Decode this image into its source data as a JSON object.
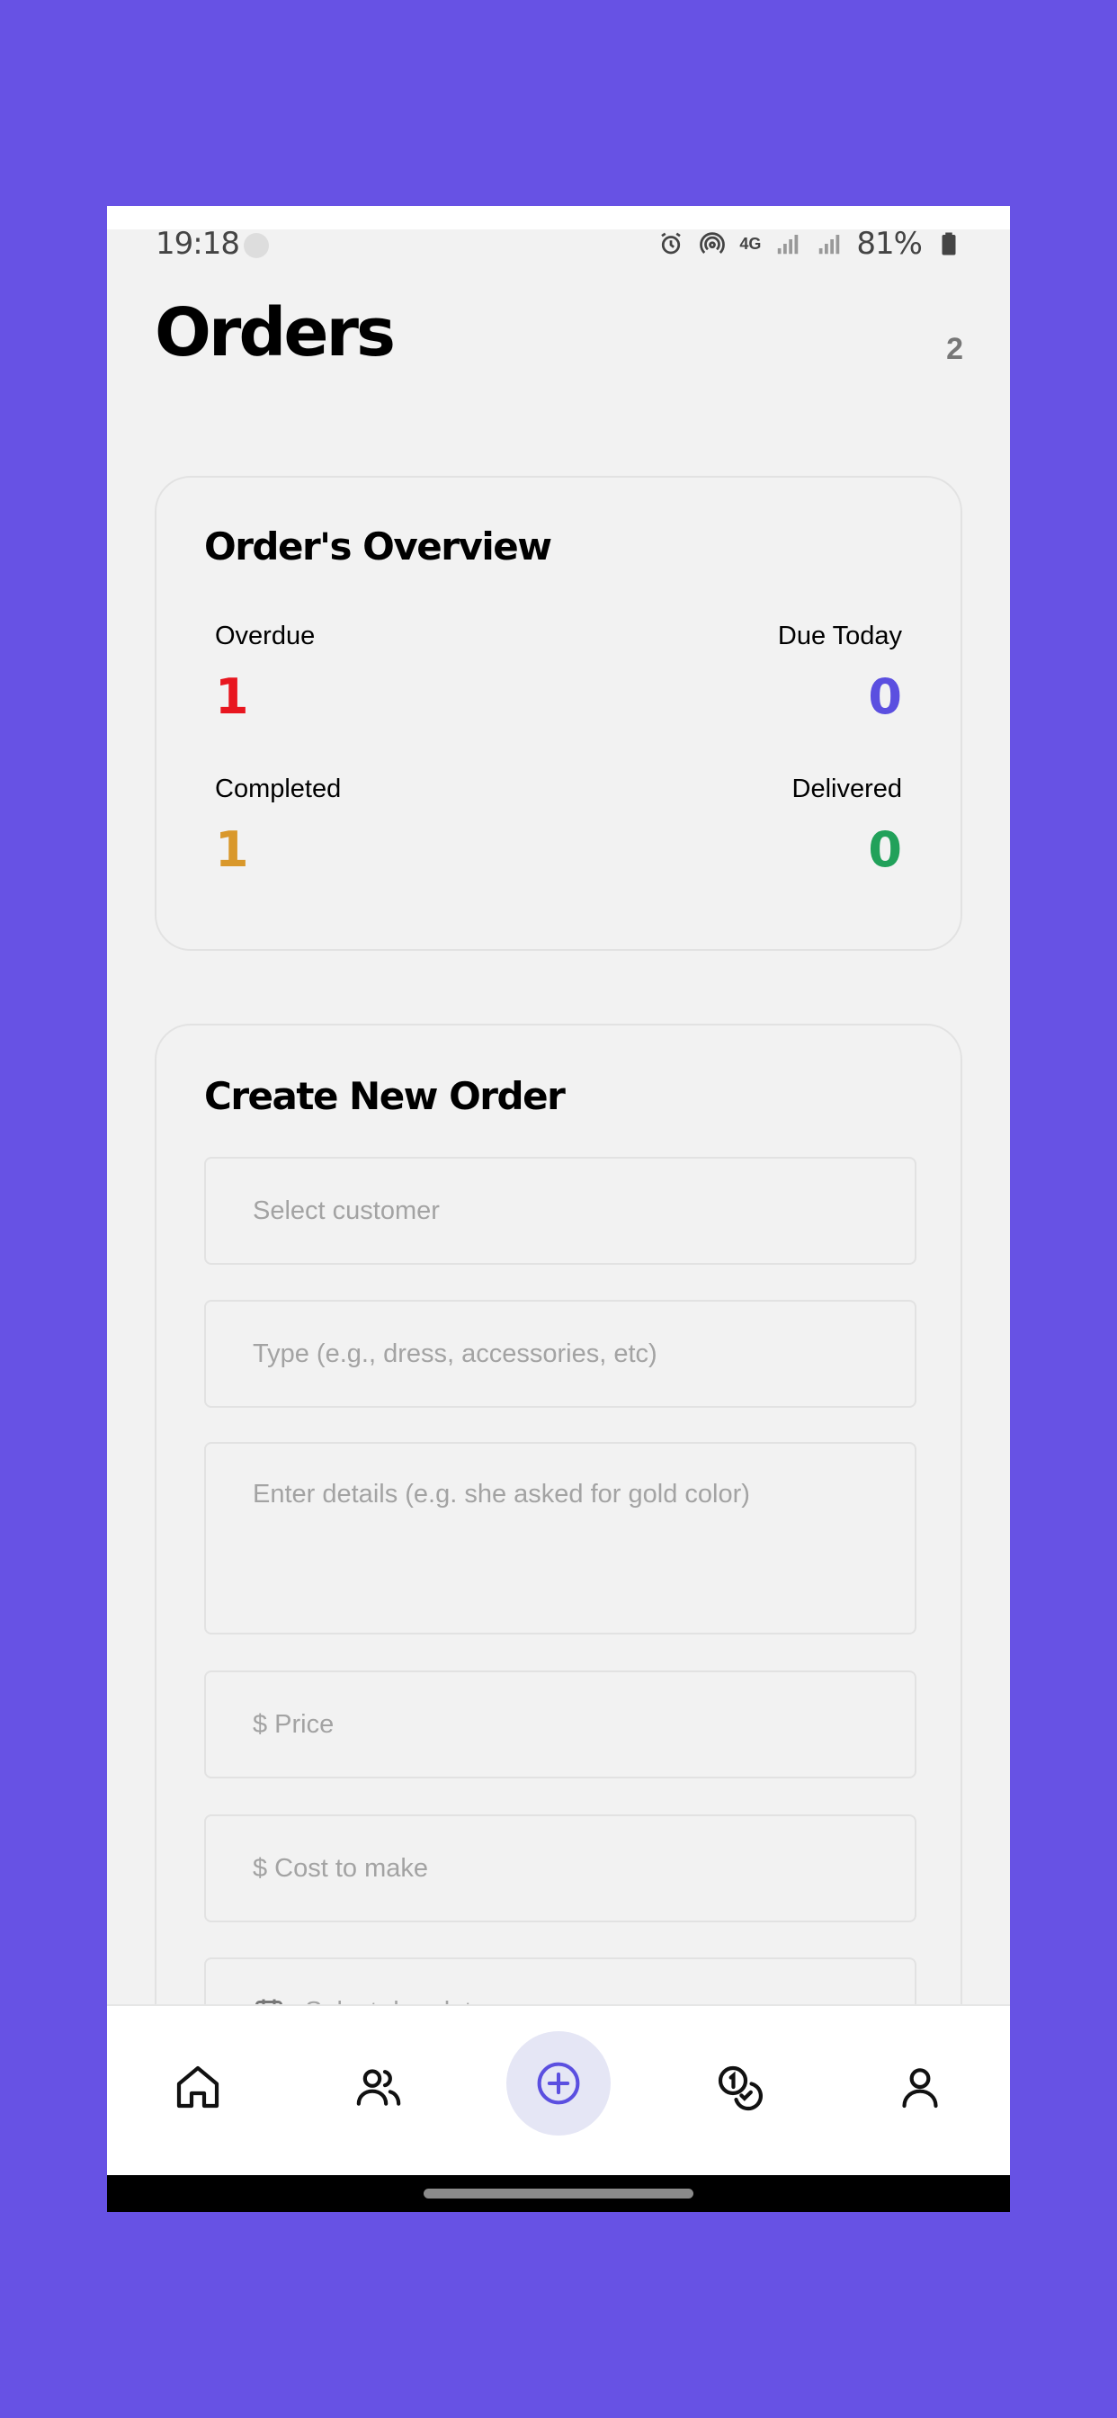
{
  "status_bar": {
    "time": "19:18",
    "network": "4G",
    "battery": "81%"
  },
  "header": {
    "title": "Orders",
    "badge": "2"
  },
  "overview": {
    "title": "Order's Overview",
    "stats": [
      {
        "label": "Overdue",
        "value": "1",
        "color": "#E8161F"
      },
      {
        "label": "Due Today",
        "value": "0",
        "color": "#5B4FE0"
      },
      {
        "label": "Completed",
        "value": "1",
        "color": "#D9982B"
      },
      {
        "label": "Delivered",
        "value": "0",
        "color": "#21A15A"
      }
    ]
  },
  "create_order": {
    "title": "Create New Order",
    "customer_placeholder": "Select customer",
    "type_placeholder": "Type (e.g., dress, accessories, etc)",
    "details_placeholder": "Enter details (e.g. she asked for gold color)",
    "price_placeholder": "$ Price",
    "cost_placeholder": "$ Cost to make",
    "due_date_placeholder": "Select due date"
  },
  "bottom_nav": {
    "items": [
      "home-icon",
      "customers-icon",
      "add-order-icon",
      "payments-icon",
      "profile-icon"
    ],
    "accent": "#5B4FE0"
  },
  "colors": {
    "background": "#6752E4",
    "surface": "#F2F2F2"
  }
}
